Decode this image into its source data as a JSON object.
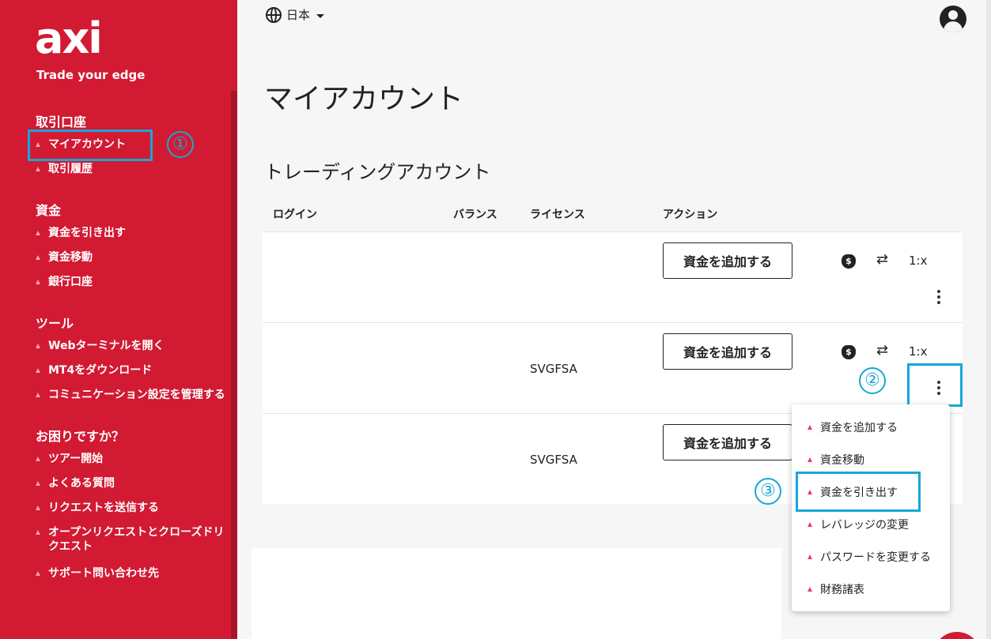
{
  "brand": {
    "logo": "axi",
    "tagline": "Trade your edge"
  },
  "sidebar": {
    "sections": [
      {
        "title": "取引口座",
        "items": [
          "マイアカウント",
          "取引履歴"
        ]
      },
      {
        "title": "資金",
        "items": [
          "資金を引き出す",
          "資金移動",
          "銀行口座"
        ]
      },
      {
        "title": "ツール",
        "items": [
          "Webターミナルを開く",
          "MT4をダウンロード",
          "コミュニケーション設定を管理する"
        ]
      },
      {
        "title": "お困りですか？",
        "items": [
          "ツアー開始",
          "よくある質問",
          "リクエストを送信する",
          "オープンリクエストとクローズドリクエスト",
          "サポート問い合わせ先"
        ]
      }
    ]
  },
  "header": {
    "language": "日本"
  },
  "main": {
    "page_title": "マイアカウント",
    "section_title": "トレーディングアカウント",
    "columns": [
      "ログイン",
      "バランス",
      "ライセンス",
      "アクション"
    ],
    "rows": [
      {
        "license": "",
        "fund_label": "資金を追加する",
        "leverage": "1:x"
      },
      {
        "license": "SVGFSA",
        "fund_label": "資金を追加する",
        "leverage": "1:x"
      },
      {
        "license": "SVGFSA",
        "fund_label": "資金を追加する",
        "leverage": ""
      }
    ]
  },
  "action_menu": {
    "items": [
      "資金を追加する",
      "資金移動",
      "資金を引き出す",
      "レバレッジの変更",
      "パスワードを変更する",
      "財務諸表"
    ]
  },
  "annotations": [
    "①",
    "②",
    "③"
  ],
  "colors": {
    "sidebar": "#d21a33",
    "annotation": "#1aa6d6",
    "bullet": "#e0445a"
  }
}
